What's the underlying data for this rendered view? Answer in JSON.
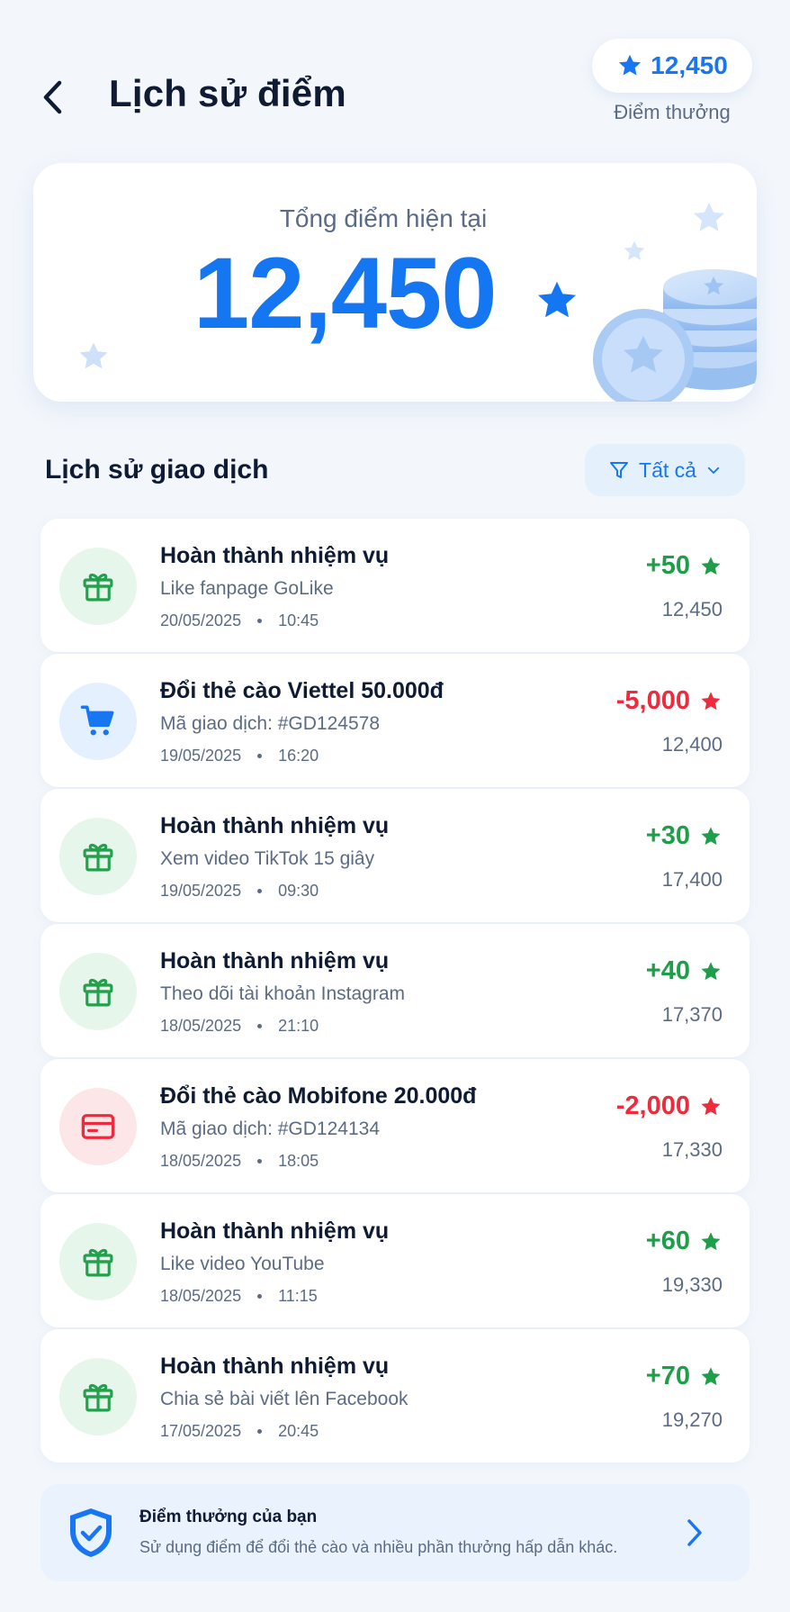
{
  "header": {
    "title": "Lịch sử điểm",
    "points_value": "12,450",
    "points_caption": "Điểm thưởng",
    "accent_color": "#1976f2"
  },
  "summary": {
    "label": "Tổng điểm hiện tại",
    "value": "12,450"
  },
  "section": {
    "title": "Lịch sử giao dịch",
    "filter_label": "Tất cả"
  },
  "transactions": [
    {
      "type": "earn",
      "icon": "gift-icon",
      "title": "Hoàn thành nhiệm vụ",
      "subtitle": "Like fanpage GoLike",
      "date": "20/05/2025",
      "time": "10:45",
      "amount": "+50",
      "balance": "12,450"
    },
    {
      "type": "spend",
      "icon": "cart-icon",
      "title": "Đổi thẻ cào Viettel 50.000đ",
      "subtitle": "Mã giao dịch: #GD124578",
      "date": "19/05/2025",
      "time": "16:20",
      "amount": "-5,000",
      "balance": "12,400"
    },
    {
      "type": "earn",
      "icon": "gift-icon",
      "title": "Hoàn thành nhiệm vụ",
      "subtitle": "Xem video TikTok 15 giây",
      "date": "19/05/2025",
      "time": "09:30",
      "amount": "+30",
      "balance": "17,400"
    },
    {
      "type": "earn",
      "icon": "gift-icon",
      "title": "Hoàn thành nhiệm vụ",
      "subtitle": "Theo dõi tài khoản Instagram",
      "date": "18/05/2025",
      "time": "21:10",
      "amount": "+40",
      "balance": "17,370"
    },
    {
      "type": "spend",
      "icon": "card-icon",
      "title": "Đổi thẻ cào Mobifone 20.000đ",
      "subtitle": "Mã giao dịch: #GD124134",
      "date": "18/05/2025",
      "time": "18:05",
      "amount": "-2,000",
      "balance": "17,330"
    },
    {
      "type": "earn",
      "icon": "gift-icon",
      "title": "Hoàn thành nhiệm vụ",
      "subtitle": "Like video YouTube",
      "date": "18/05/2025",
      "time": "11:15",
      "amount": "+60",
      "balance": "19,330"
    },
    {
      "type": "earn",
      "icon": "gift-icon",
      "title": "Hoàn thành nhiệm vụ",
      "subtitle": "Chia sẻ bài viết lên Facebook",
      "date": "17/05/2025",
      "time": "20:45",
      "amount": "+70",
      "balance": "19,270"
    }
  ],
  "footer": {
    "title": "Điểm thưởng của bạn",
    "subtitle": "Sử dụng điểm để đổi thẻ cào và nhiều phần thưởng hấp dẫn khác."
  },
  "colors": {
    "positive": "#1f9e4a",
    "negative": "#ee2b3c",
    "primary": "#1476f0"
  }
}
